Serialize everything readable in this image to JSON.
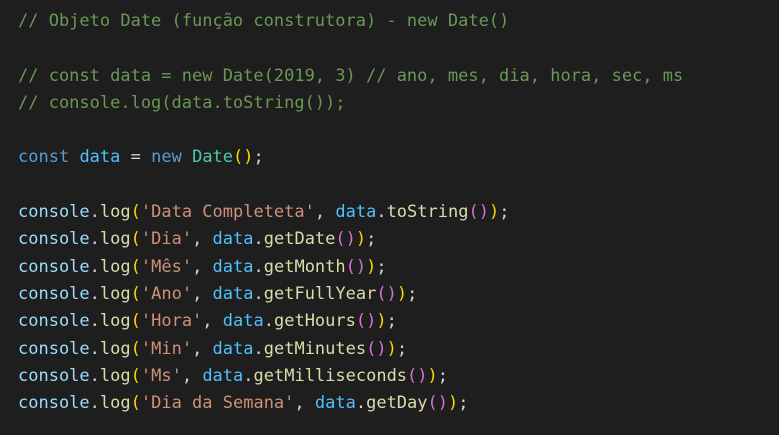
{
  "colors": {
    "background": "#1e1e1e",
    "comment": "#6a9955",
    "keyword": "#569cd6",
    "variable": "#4fc1ff",
    "plain": "#d4d4d4",
    "function": "#dcdcaa",
    "class": "#4ec9b0",
    "string": "#ce9178",
    "object": "#9cdcfe",
    "bracket_1": "#ffd700",
    "bracket_2": "#da70d6"
  },
  "code_lines": [
    [
      {
        "t": "// Objeto Date (função construtora) - new Date()",
        "k": "comment"
      }
    ],
    [],
    [
      {
        "t": "// const data = new Date(2019, 3) // ano, mes, dia, hora, sec, ms",
        "k": "comment"
      }
    ],
    [
      {
        "t": "// console.log(data.toString());",
        "k": "comment"
      }
    ],
    [],
    [
      {
        "t": "const",
        "k": "keyword"
      },
      {
        "t": " ",
        "k": "plain"
      },
      {
        "t": "data",
        "k": "variable"
      },
      {
        "t": " = ",
        "k": "plain"
      },
      {
        "t": "new",
        "k": "keyword"
      },
      {
        "t": " ",
        "k": "plain"
      },
      {
        "t": "Date",
        "k": "class"
      },
      {
        "t": "()",
        "k": "bracket-1"
      },
      {
        "t": ";",
        "k": "plain"
      }
    ],
    [],
    [
      {
        "t": "console",
        "k": "object"
      },
      {
        "t": ".",
        "k": "plain"
      },
      {
        "t": "log",
        "k": "function"
      },
      {
        "t": "(",
        "k": "bracket-1"
      },
      {
        "t": "'Data Completeta'",
        "k": "string"
      },
      {
        "t": ", ",
        "k": "plain"
      },
      {
        "t": "data",
        "k": "variable"
      },
      {
        "t": ".",
        "k": "plain"
      },
      {
        "t": "toString",
        "k": "function"
      },
      {
        "t": "()",
        "k": "bracket-2"
      },
      {
        "t": ")",
        "k": "bracket-1"
      },
      {
        "t": ";",
        "k": "plain"
      }
    ],
    [
      {
        "t": "console",
        "k": "object"
      },
      {
        "t": ".",
        "k": "plain"
      },
      {
        "t": "log",
        "k": "function"
      },
      {
        "t": "(",
        "k": "bracket-1"
      },
      {
        "t": "'Dia'",
        "k": "string"
      },
      {
        "t": ", ",
        "k": "plain"
      },
      {
        "t": "data",
        "k": "variable"
      },
      {
        "t": ".",
        "k": "plain"
      },
      {
        "t": "getDate",
        "k": "function"
      },
      {
        "t": "()",
        "k": "bracket-2"
      },
      {
        "t": ")",
        "k": "bracket-1"
      },
      {
        "t": ";",
        "k": "plain"
      }
    ],
    [
      {
        "t": "console",
        "k": "object"
      },
      {
        "t": ".",
        "k": "plain"
      },
      {
        "t": "log",
        "k": "function"
      },
      {
        "t": "(",
        "k": "bracket-1"
      },
      {
        "t": "'Mês'",
        "k": "string"
      },
      {
        "t": ", ",
        "k": "plain"
      },
      {
        "t": "data",
        "k": "variable"
      },
      {
        "t": ".",
        "k": "plain"
      },
      {
        "t": "getMonth",
        "k": "function"
      },
      {
        "t": "()",
        "k": "bracket-2"
      },
      {
        "t": ")",
        "k": "bracket-1"
      },
      {
        "t": ";",
        "k": "plain"
      }
    ],
    [
      {
        "t": "console",
        "k": "object"
      },
      {
        "t": ".",
        "k": "plain"
      },
      {
        "t": "log",
        "k": "function"
      },
      {
        "t": "(",
        "k": "bracket-1"
      },
      {
        "t": "'Ano'",
        "k": "string"
      },
      {
        "t": ", ",
        "k": "plain"
      },
      {
        "t": "data",
        "k": "variable"
      },
      {
        "t": ".",
        "k": "plain"
      },
      {
        "t": "getFullYear",
        "k": "function"
      },
      {
        "t": "()",
        "k": "bracket-2"
      },
      {
        "t": ")",
        "k": "bracket-1"
      },
      {
        "t": ";",
        "k": "plain"
      }
    ],
    [
      {
        "t": "console",
        "k": "object"
      },
      {
        "t": ".",
        "k": "plain"
      },
      {
        "t": "log",
        "k": "function"
      },
      {
        "t": "(",
        "k": "bracket-1"
      },
      {
        "t": "'Hora'",
        "k": "string"
      },
      {
        "t": ", ",
        "k": "plain"
      },
      {
        "t": "data",
        "k": "variable"
      },
      {
        "t": ".",
        "k": "plain"
      },
      {
        "t": "getHours",
        "k": "function"
      },
      {
        "t": "()",
        "k": "bracket-2"
      },
      {
        "t": ")",
        "k": "bracket-1"
      },
      {
        "t": ";",
        "k": "plain"
      }
    ],
    [
      {
        "t": "console",
        "k": "object"
      },
      {
        "t": ".",
        "k": "plain"
      },
      {
        "t": "log",
        "k": "function"
      },
      {
        "t": "(",
        "k": "bracket-1"
      },
      {
        "t": "'Min'",
        "k": "string"
      },
      {
        "t": ", ",
        "k": "plain"
      },
      {
        "t": "data",
        "k": "variable"
      },
      {
        "t": ".",
        "k": "plain"
      },
      {
        "t": "getMinutes",
        "k": "function"
      },
      {
        "t": "()",
        "k": "bracket-2"
      },
      {
        "t": ")",
        "k": "bracket-1"
      },
      {
        "t": ";",
        "k": "plain"
      }
    ],
    [
      {
        "t": "console",
        "k": "object"
      },
      {
        "t": ".",
        "k": "plain"
      },
      {
        "t": "log",
        "k": "function"
      },
      {
        "t": "(",
        "k": "bracket-1"
      },
      {
        "t": "'Ms'",
        "k": "string"
      },
      {
        "t": ", ",
        "k": "plain"
      },
      {
        "t": "data",
        "k": "variable"
      },
      {
        "t": ".",
        "k": "plain"
      },
      {
        "t": "getMilliseconds",
        "k": "function"
      },
      {
        "t": "()",
        "k": "bracket-2"
      },
      {
        "t": ")",
        "k": "bracket-1"
      },
      {
        "t": ";",
        "k": "plain"
      }
    ],
    [
      {
        "t": "console",
        "k": "object"
      },
      {
        "t": ".",
        "k": "plain"
      },
      {
        "t": "log",
        "k": "function"
      },
      {
        "t": "(",
        "k": "bracket-1"
      },
      {
        "t": "'Dia da Semana'",
        "k": "string"
      },
      {
        "t": ", ",
        "k": "plain"
      },
      {
        "t": "data",
        "k": "variable"
      },
      {
        "t": ".",
        "k": "plain"
      },
      {
        "t": "getDay",
        "k": "function"
      },
      {
        "t": "()",
        "k": "bracket-2"
      },
      {
        "t": ")",
        "k": "bracket-1"
      },
      {
        "t": ";",
        "k": "plain"
      }
    ]
  ]
}
